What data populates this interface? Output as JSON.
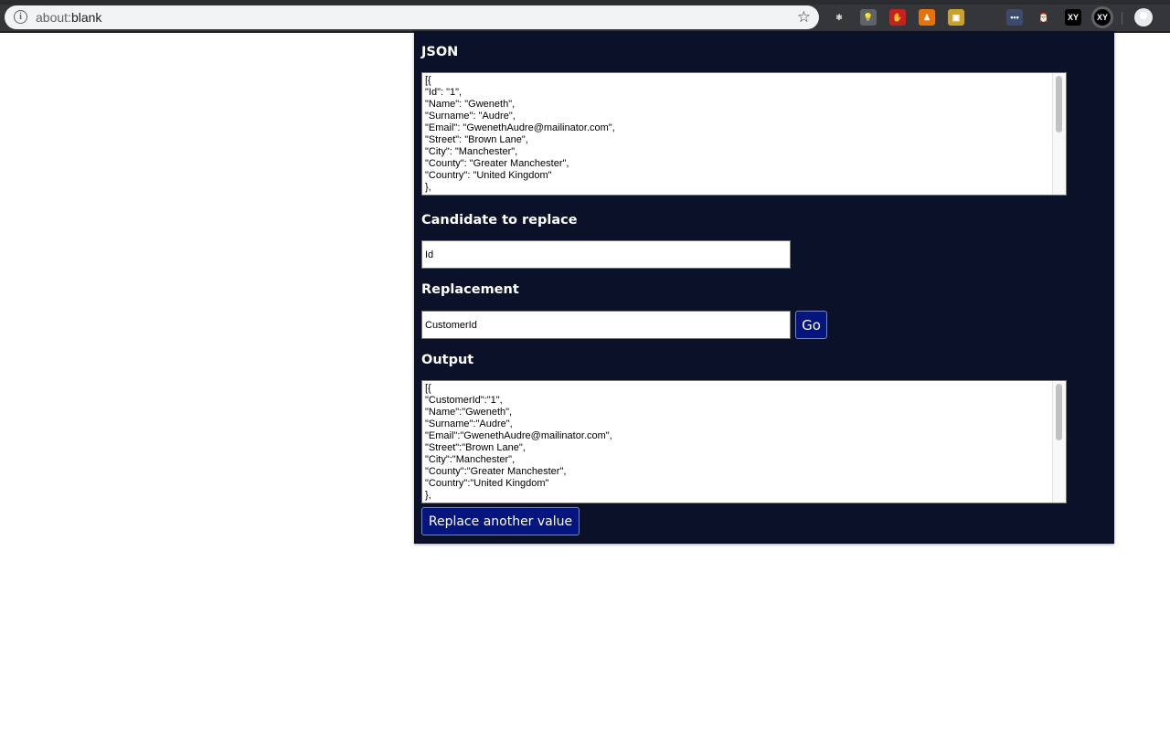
{
  "browser": {
    "url_scheme": "about:",
    "url_rest": "blank",
    "extensions": [
      {
        "icon": "react-icon",
        "glyph": "⚛",
        "color": "#35363a",
        "fg": "#ffffff"
      },
      {
        "icon": "lightbulb-icon",
        "glyph": "💡",
        "color": "#5f6368",
        "fg": "#ffffff"
      },
      {
        "icon": "stop-hand-icon",
        "glyph": "✋",
        "color": "#c5221f",
        "fg": "#ffffff"
      },
      {
        "icon": "figure-icon",
        "glyph": "♟",
        "color": "#e8710a",
        "fg": "#ffffff"
      },
      {
        "icon": "picture-icon",
        "glyph": "▣",
        "color": "#c9a227",
        "fg": "#ffffff"
      },
      {
        "icon": "dots-icon",
        "glyph": "•••",
        "color": "#3c4a6b",
        "fg": "#ffffff"
      },
      {
        "icon": "santa-icon",
        "glyph": "🎅",
        "color": "#35363a",
        "fg": "#ffffff"
      },
      {
        "icon": "xy-icon",
        "glyph": "XY",
        "color": "#000000",
        "fg": "#ffffff"
      },
      {
        "icon": "xy-active-icon",
        "glyph": "XY",
        "color": "#000000",
        "fg": "#ffffff"
      }
    ]
  },
  "popup": {
    "json_heading": "JSON",
    "json_lines": [
      "[{",
      "\"Id\": \"1\",",
      "\"Name\": \"Gweneth\",",
      "\"Surname\": \"Audre\",",
      "\"Email\": \"GwenethAudre@mailinator.com\",",
      "\"Street\": \"Brown Lane\",",
      "\"City\": \"Manchester\",",
      "\"County\": \"Greater Manchester\",",
      "\"Country\": \"United Kingdom\"",
      "},"
    ],
    "candidate_heading": "Candidate to replace",
    "candidate_value": "Id",
    "replacement_heading": "Replacement",
    "replacement_value": "CustomerId",
    "go_label": "Go",
    "output_heading": "Output",
    "output_lines": [
      "[{",
      "\"CustomerId\":\"1\",",
      "\"Name\":\"Gweneth\",",
      "\"Surname\":\"Audre\",",
      "\"Email\":\"GwenethAudre@mailinator.com\",",
      "\"Street\":\"Brown Lane\",",
      "\"City\":\"Manchester\",",
      "\"County\":\"Greater Manchester\",",
      "\"Country\":\"United Kingdom\"",
      "},"
    ],
    "replace_another_label": "Replace another value"
  }
}
